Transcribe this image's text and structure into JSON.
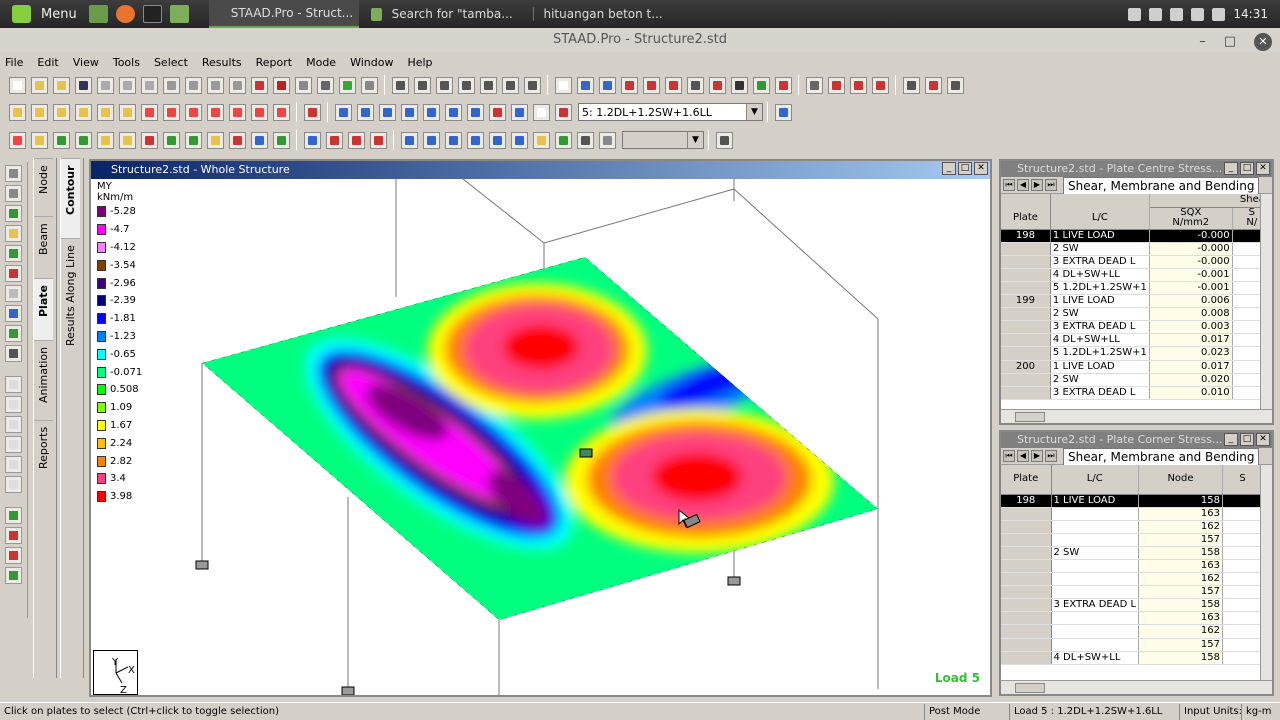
{
  "taskbar": {
    "menu_label": "Menu",
    "tasks": [
      "STAAD.Pro - Struct...",
      "Search for \"tamba...",
      "hituangan beton t..."
    ],
    "clock": "14:31"
  },
  "window": {
    "title": "STAAD.Pro - Structure2.std"
  },
  "menubar": [
    "File",
    "Edit",
    "View",
    "Tools",
    "Select",
    "Results",
    "Report",
    "Mode",
    "Window",
    "Help"
  ],
  "toolbar": {
    "load_case_value": "5: 1.2DL+1.2SW+1.6LL"
  },
  "side_tabs_left": [
    "Node",
    "Beam",
    "Plate",
    "Animation",
    "Reports"
  ],
  "side_tabs_right": [
    "Contour",
    "Results Along Line"
  ],
  "structure_window": {
    "title": "Structure2.std - Whole Structure",
    "legend_title": "MY",
    "legend_unit": "kNm/m",
    "legend": [
      {
        "value": "-5.28",
        "color": "#7f007f"
      },
      {
        "value": "-4.7",
        "color": "#ff00ff"
      },
      {
        "value": "-4.12",
        "color": "#ff7fff"
      },
      {
        "value": "-3.54",
        "color": "#7f3f00"
      },
      {
        "value": "-2.96",
        "color": "#3f007f"
      },
      {
        "value": "-2.39",
        "color": "#00007f"
      },
      {
        "value": "-1.81",
        "color": "#0000ff"
      },
      {
        "value": "-1.23",
        "color": "#007fff"
      },
      {
        "value": "-0.65",
        "color": "#00ffff"
      },
      {
        "value": "-0.071",
        "color": "#00ff7f"
      },
      {
        "value": "0.508",
        "color": "#00ff00"
      },
      {
        "value": "1.09",
        "color": "#7fff00"
      },
      {
        "value": "1.67",
        "color": "#ffff00"
      },
      {
        "value": "2.24",
        "color": "#ffbf00"
      },
      {
        "value": "2.82",
        "color": "#ff7f00"
      },
      {
        "value": "3.4",
        "color": "#ff3f7f"
      },
      {
        "value": "3.98",
        "color": "#ff0000"
      }
    ],
    "axis_y": "Y",
    "axis_x": "X",
    "axis_z": "Z",
    "load_label": "Load 5"
  },
  "panel1": {
    "title": "Structure2.std - Plate Centre Stress...",
    "tab": "Shear, Membrane and Bending",
    "group_header": "Shear",
    "columns": [
      "Plate",
      "L/C",
      "SQX\nN/mm2",
      "S\nN/"
    ],
    "rows": [
      {
        "plate": "198",
        "lc": "1 LIVE LOAD",
        "val": "-0.000"
      },
      {
        "plate": "",
        "lc": "2 SW",
        "val": "-0.000"
      },
      {
        "plate": "",
        "lc": "3 EXTRA DEAD L",
        "val": "-0.000"
      },
      {
        "plate": "",
        "lc": "4 DL+SW+LL",
        "val": "-0.001"
      },
      {
        "plate": "",
        "lc": "5 1.2DL+1.2SW+1",
        "val": "-0.001"
      },
      {
        "plate": "199",
        "lc": "1 LIVE LOAD",
        "val": "0.006"
      },
      {
        "plate": "",
        "lc": "2 SW",
        "val": "0.008"
      },
      {
        "plate": "",
        "lc": "3 EXTRA DEAD L",
        "val": "0.003"
      },
      {
        "plate": "",
        "lc": "4 DL+SW+LL",
        "val": "0.017"
      },
      {
        "plate": "",
        "lc": "5 1.2DL+1.2SW+1",
        "val": "0.023"
      },
      {
        "plate": "200",
        "lc": "1 LIVE LOAD",
        "val": "0.017"
      },
      {
        "plate": "",
        "lc": "2 SW",
        "val": "0.020"
      },
      {
        "plate": "",
        "lc": "3 EXTRA DEAD L",
        "val": "0.010"
      }
    ]
  },
  "panel2": {
    "title": "Structure2.std - Plate Corner Stress...",
    "tab": "Shear, Membrane and Bending",
    "columns": [
      "Plate",
      "L/C",
      "Node",
      "S"
    ],
    "rows": [
      {
        "plate": "198",
        "lc": "1 LIVE LOAD",
        "node": "158"
      },
      {
        "plate": "",
        "lc": "",
        "node": "163"
      },
      {
        "plate": "",
        "lc": "",
        "node": "162"
      },
      {
        "plate": "",
        "lc": "",
        "node": "157"
      },
      {
        "plate": "",
        "lc": "2 SW",
        "node": "158"
      },
      {
        "plate": "",
        "lc": "",
        "node": "163"
      },
      {
        "plate": "",
        "lc": "",
        "node": "162"
      },
      {
        "plate": "",
        "lc": "",
        "node": "157"
      },
      {
        "plate": "",
        "lc": "3 EXTRA DEAD L",
        "node": "158"
      },
      {
        "plate": "",
        "lc": "",
        "node": "163"
      },
      {
        "plate": "",
        "lc": "",
        "node": "162"
      },
      {
        "plate": "",
        "lc": "",
        "node": "157"
      },
      {
        "plate": "",
        "lc": "4 DL+SW+LL",
        "node": "158"
      }
    ]
  },
  "statusbar": {
    "hint": "Click on plates to select (Ctrl+click to toggle selection)",
    "mode": "Post Mode",
    "load": "Load 5 : 1.2DL+1.2SW+1.6LL",
    "input_units_label": "Input Units:",
    "input_units_value": "kg-m"
  }
}
